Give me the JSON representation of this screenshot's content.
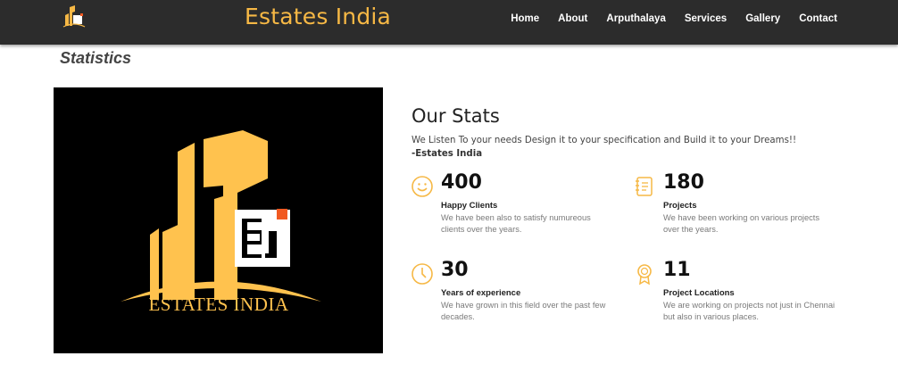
{
  "nav": {
    "brand": "Estates India",
    "menu": [
      "Home",
      "About",
      "Arputhalaya",
      "Services",
      "Gallery",
      "Contact"
    ]
  },
  "section_title": "Statistics",
  "logo": {
    "text": "ESTATES INDIA",
    "mark": "Ei"
  },
  "stats": {
    "heading": "Our Stats",
    "description": "We Listen To your needs Design it to your specification and Build it to your Dreams!!",
    "signature": "-Estates India",
    "items": [
      {
        "icon": "smiley-icon",
        "number": "400",
        "label": "Happy Clients",
        "desc": "We have been also to satisfy numureous clients over the years."
      },
      {
        "icon": "notepad-icon",
        "number": "180",
        "label": "Projects",
        "desc": "We have been working on various projects over the years."
      },
      {
        "icon": "clock-icon",
        "number": "30",
        "label": "Years of experience",
        "desc": "We have grown in this field over the past few decades."
      },
      {
        "icon": "award-icon",
        "number": "11",
        "label": "Project Locations",
        "desc": "We are working on projects not just in Chennai but also in various places."
      }
    ]
  },
  "colors": {
    "accent": "#f6b845",
    "nav_bg": "#2c2c2c",
    "logo_orange": "#f15a22"
  }
}
